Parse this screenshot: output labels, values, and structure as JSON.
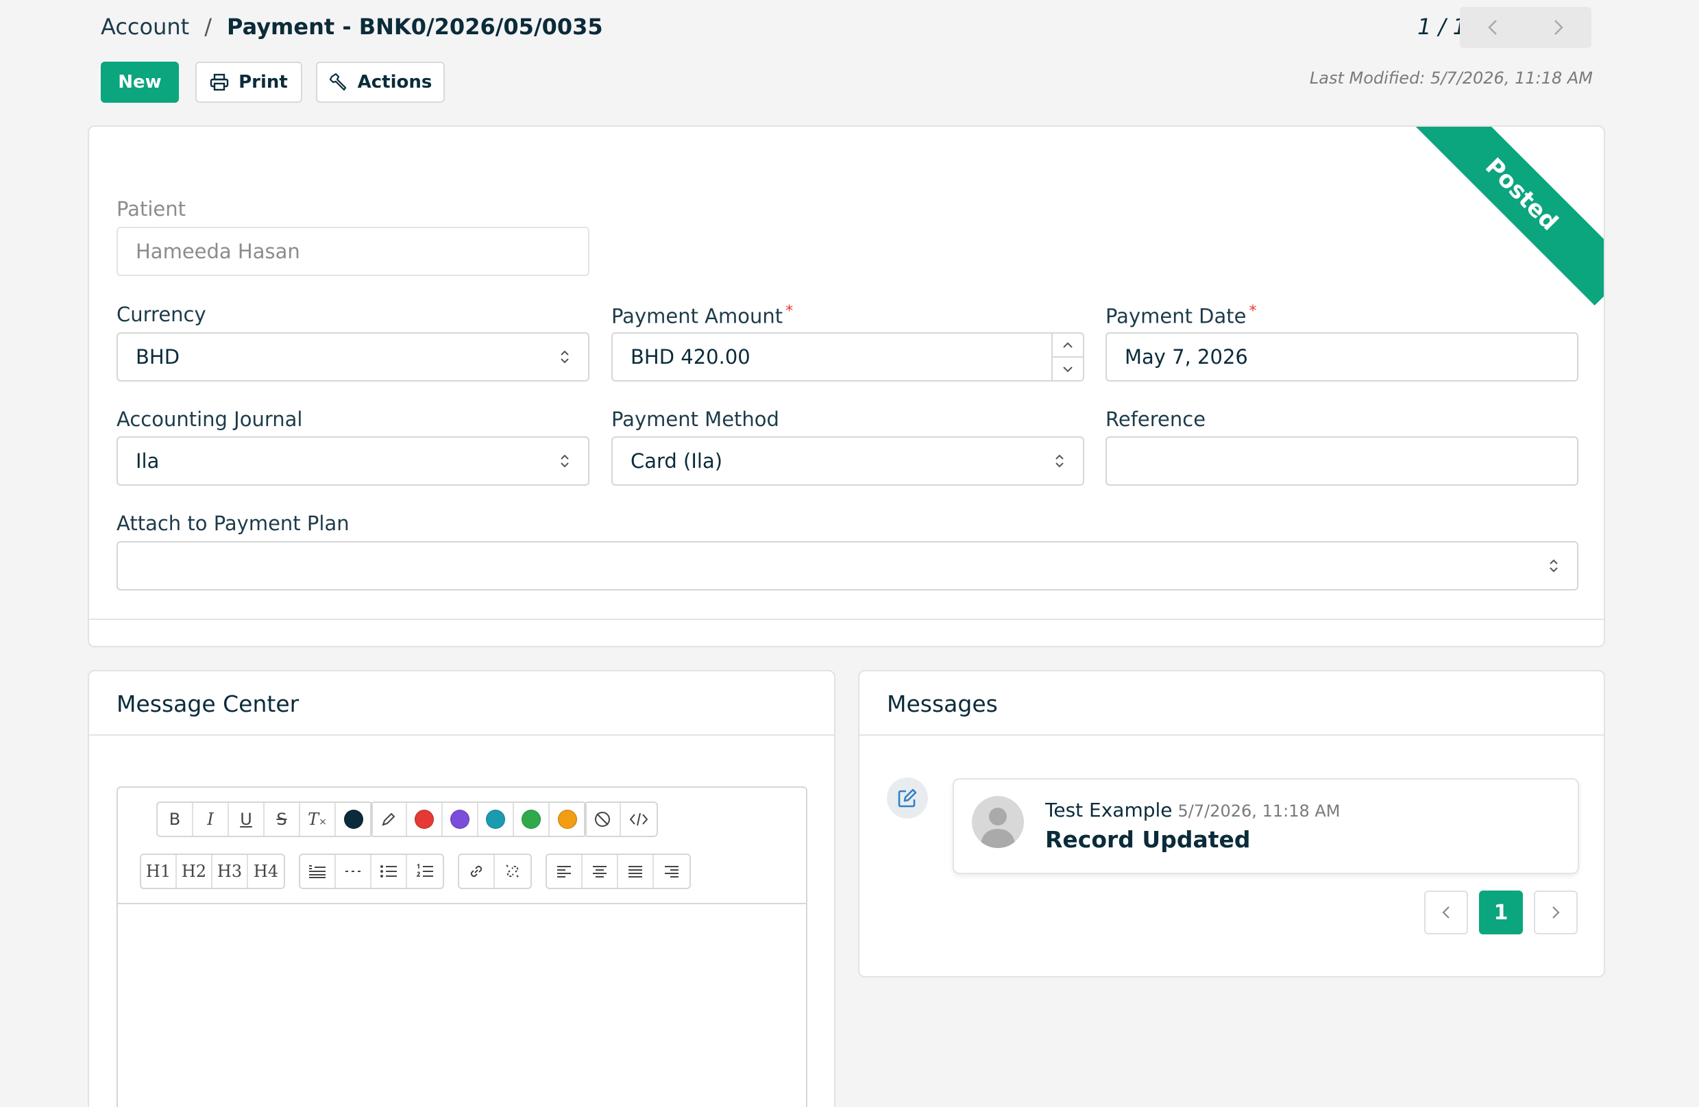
{
  "breadcrumb": {
    "parent": "Account",
    "separator": "/",
    "current": "Payment - BNK0/2026/05/0035"
  },
  "pager": {
    "count": "1 / 1",
    "prev_icon": "chevron-left-icon",
    "next_icon": "chevron-right-icon"
  },
  "toolbar": {
    "new_label": "New",
    "print_label": "Print",
    "actions_label": "Actions"
  },
  "last_modified": "Last Modified: 5/7/2026, 11:18 AM",
  "status_ribbon": "Posted",
  "form": {
    "patient": {
      "label": "Patient",
      "value": "Hameeda Hasan"
    },
    "currency": {
      "label": "Currency",
      "value": "BHD"
    },
    "payment_amount": {
      "label": "Payment Amount",
      "value": "BHD 420.00",
      "required": "*"
    },
    "payment_date": {
      "label": "Payment Date",
      "value": "May 7, 2026",
      "required": "*"
    },
    "accounting_journal": {
      "label": "Accounting Journal",
      "value": "Ila"
    },
    "payment_method": {
      "label": "Payment Method",
      "value": "Card (Ila)"
    },
    "reference": {
      "label": "Reference",
      "value": ""
    },
    "payment_plan": {
      "label": "Attach to Payment Plan",
      "value": ""
    }
  },
  "message_center": {
    "title": "Message Center",
    "text_colors": [
      "#0b2b3a",
      "#e53935",
      "#7c4ddb",
      "#1a9bb0",
      "#2eaa4a",
      "#f29d12"
    ],
    "headings": [
      "H1",
      "H2",
      "H3",
      "H4"
    ]
  },
  "messages": {
    "title": "Messages",
    "items": [
      {
        "author": "Test Example",
        "time": "5/7/2026, 11:18 AM",
        "body": "Record Updated"
      }
    ],
    "pagination": {
      "current": "1"
    }
  },
  "colors": {
    "accent": "#0ba57e",
    "required": "#e53935",
    "text": "#0b2b3a"
  }
}
